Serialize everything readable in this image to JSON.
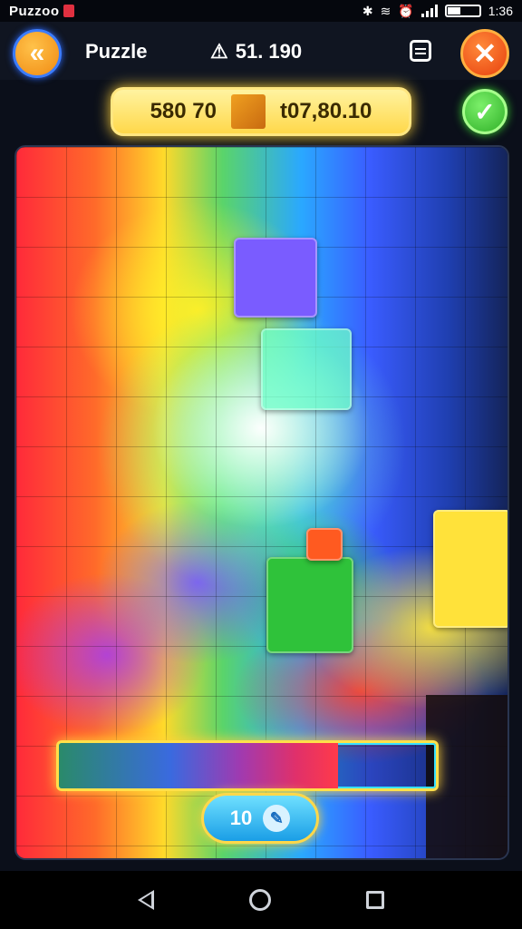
{
  "status": {
    "app_name": "Puzzoo",
    "time": "1:36",
    "icons": [
      "bluetooth-icon",
      "wifi-icon",
      "alarm-icon",
      "signal-icon",
      "battery-icon"
    ]
  },
  "header": {
    "title": "Puzzle",
    "score": "51. 190",
    "back_icon": "chevron-left-icon",
    "close_icon": "close-icon",
    "menu_icon": "menu-icon"
  },
  "info": {
    "left": "580 70",
    "right": "t07,80.10"
  },
  "board": {
    "progress": 0.74
  },
  "hint": {
    "label": "10",
    "icon": "puzzle-hint-icon"
  },
  "colors": {
    "accent": "#ffd23a",
    "confirm": "#2fb028",
    "close": "#e8400e",
    "back": "#f08a12"
  }
}
